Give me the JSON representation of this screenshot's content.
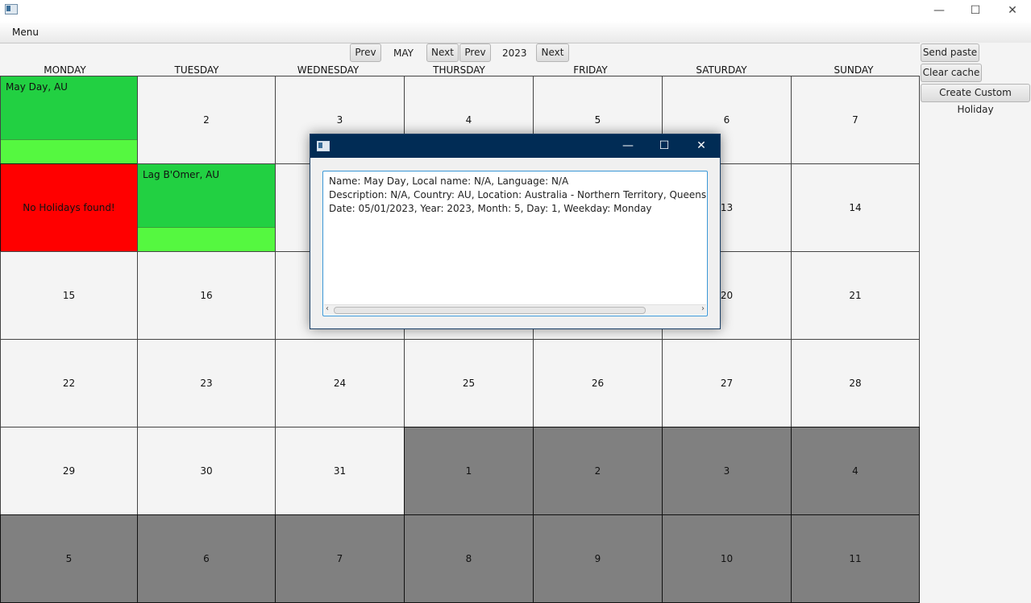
{
  "window": {
    "minimize_icon": "minimize-icon",
    "maximize_icon": "maximize-icon",
    "close_icon": "close-icon"
  },
  "menubar": {
    "menu_label": "Menu"
  },
  "nav": {
    "prev_month_label": "Prev",
    "month": "MAY",
    "next_month_label": "Next",
    "prev_year_label": "Prev",
    "year": "2023",
    "next_year_label": "Next"
  },
  "sidebar": {
    "send_paste_label": "Send paste",
    "clear_cache_label": "Clear cache",
    "create_custom_holiday_label": "Create Custom Holiday"
  },
  "weekdays": [
    "MONDAY",
    "TUESDAY",
    "WEDNESDAY",
    "THURSDAY",
    "FRIDAY",
    "SATURDAY",
    "SUNDAY"
  ],
  "calendar": {
    "weeks": [
      [
        "",
        "2",
        "3",
        "4",
        "5",
        "6",
        "7"
      ],
      [
        "",
        "",
        "",
        "",
        "",
        "13",
        "14"
      ],
      [
        "15",
        "16",
        "",
        "",
        "",
        "20",
        "21"
      ],
      [
        "22",
        "23",
        "24",
        "25",
        "26",
        "27",
        "28"
      ],
      [
        "29",
        "30",
        "31",
        "1",
        "2",
        "3",
        "4"
      ],
      [
        "5",
        "6",
        "7",
        "8",
        "9",
        "10",
        "11"
      ]
    ],
    "holiday_may_day": "May Day, AU",
    "holiday_lag_bomer": "Lag B'Omer, AU",
    "no_holidays_text": "No Holidays found!",
    "colors": {
      "holiday_green": "#22d042",
      "holiday_light_green": "#55f840",
      "no_holiday_red": "#ff0000",
      "outside_month_grey": "#808080"
    }
  },
  "dialog": {
    "title_bar_color": "#012c55",
    "lines": [
      "Name: May Day, Local name: N/A, Language: N/A",
      "Description: N/A, Country: AU, Location: Australia - Northern Territory, Queensland, Type",
      "Date: 05/01/2023, Year: 2023, Month: 5, Day: 1, Weekday: Monday"
    ]
  }
}
